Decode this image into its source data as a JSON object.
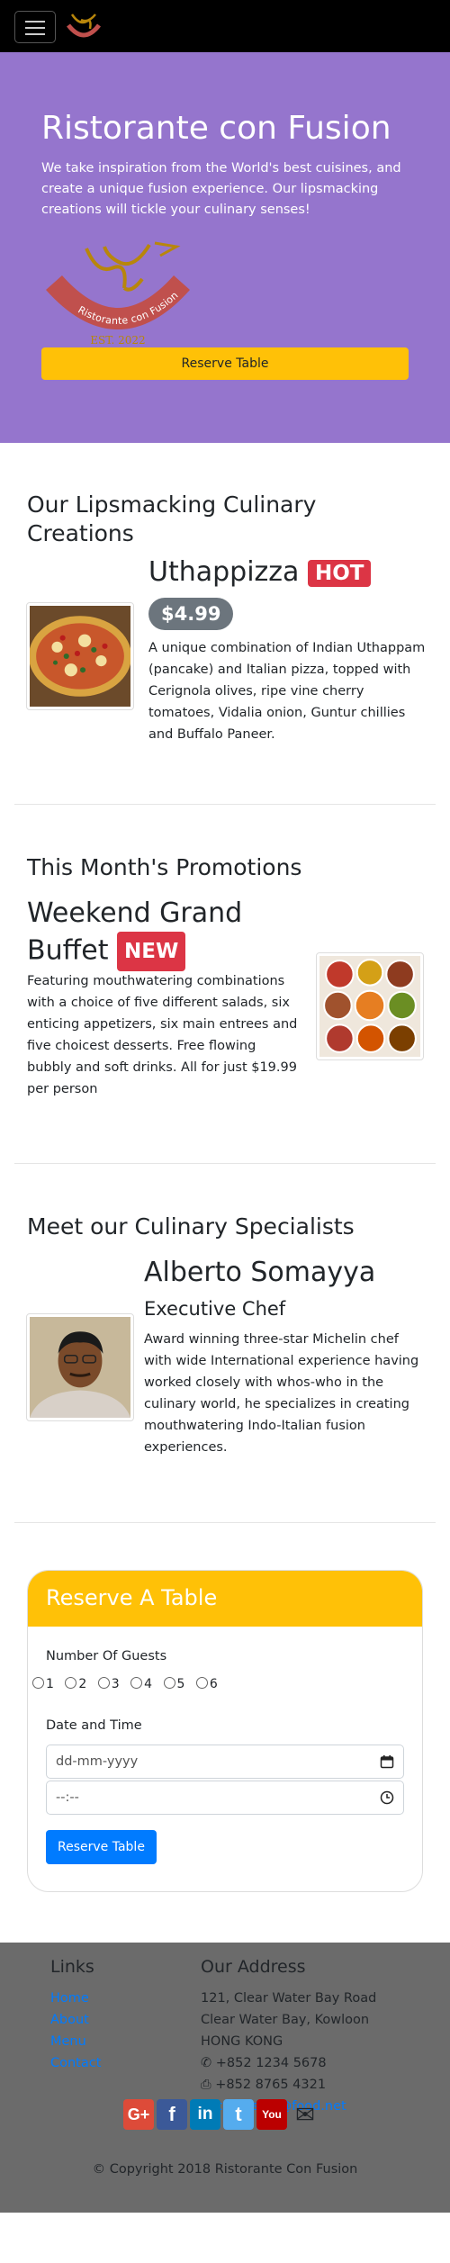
{
  "navbar": {
    "menu_icon": "hamburger-icon",
    "logo_icon": "restaurant-logo-icon"
  },
  "hero": {
    "title": "Ristorante con Fusion",
    "text": "We take inspiration from the World's best cuisines, and create a unique fusion experience. Our lipsmacking creations will tickle your culinary senses!",
    "logo_text": "Ristorante con Fusion",
    "logo_est": "EST. 2022",
    "reserve_label": "Reserve Table"
  },
  "dish": {
    "section_title": "Our Lipsmacking Culinary Creations",
    "name": "Uthappizza",
    "badge": "HOT",
    "price": "$4.99",
    "description": "A unique combination of Indian Uthappam (pancake) and Italian pizza, topped with Cerignola olives, ripe vine cherry tomatoes, Vidalia onion, Guntur chillies and Buffalo Paneer."
  },
  "promotion": {
    "section_title": "This Month's Promotions",
    "name_line1": "Weekend Grand",
    "name_line2": "Buffet",
    "badge": "NEW",
    "description": "Featuring mouthwatering combinations with a choice of five different salads, six enticing appetizers, six main entrees and five choicest desserts. Free flowing bubbly and soft drinks. All for just $19.99 per person"
  },
  "leader": {
    "section_title": "Meet our Culinary Specialists",
    "name": "Alberto Somayya",
    "role": "Executive Chef",
    "description": "Award winning three-star Michelin chef with wide International experience having worked closely with whos-who in the culinary world, he specializes in creating mouthwatering Indo-Italian fusion experiences."
  },
  "reservation": {
    "title": "Reserve A Table",
    "guests_label": "Number Of Guests",
    "guest_options": [
      "1",
      "2",
      "3",
      "4",
      "5",
      "6"
    ],
    "datetime_label": "Date and Time",
    "date_placeholder": "dd-mm-yyyy",
    "time_placeholder": "--:--",
    "submit_label": "Reserve Table"
  },
  "footer": {
    "links_title": "Links",
    "links": [
      "Home",
      "About",
      "Menu",
      "Contact"
    ],
    "address_title": "Our Address",
    "address_lines": [
      "121, Clear Water Bay Road",
      "Clear Water Bay, Kowloon",
      "HONG KONG"
    ],
    "phone": "+852 1234 5678",
    "fax": "+852 8765 4321",
    "email": "confusion@food.net",
    "social": [
      {
        "name": "google-plus",
        "glyph": "G+",
        "color": "#dd4b39"
      },
      {
        "name": "facebook",
        "glyph": "f",
        "color": "#3b5998"
      },
      {
        "name": "linkedin",
        "glyph": "in",
        "color": "#007bb6"
      },
      {
        "name": "twitter",
        "glyph": "t",
        "color": "#55acee"
      },
      {
        "name": "youtube",
        "glyph": "You",
        "color": "#bb0000"
      }
    ],
    "copyright": "© Copyright 2018 Ristorante Con Fusion"
  },
  "colors": {
    "hero_bg": "#9575cd",
    "accent_yellow": "#ffc107",
    "badge_red": "#dc3545",
    "primary_blue": "#007bff",
    "footer_bg": "#6b6b6b"
  }
}
